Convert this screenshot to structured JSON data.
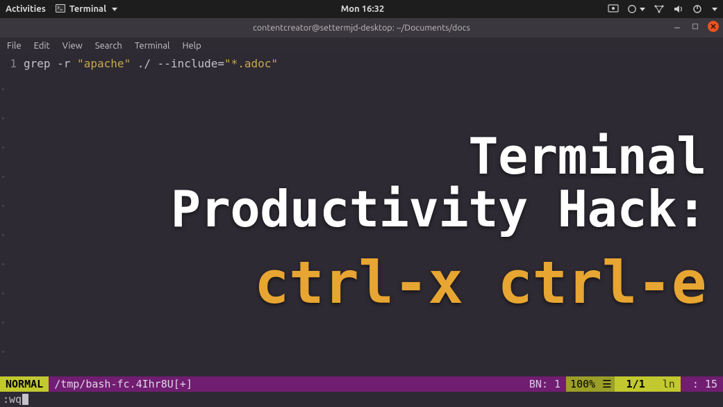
{
  "topbar": {
    "activities": "Activities",
    "app_name": "Terminal",
    "clock": "Mon 16:32"
  },
  "window": {
    "title": "contentcreator@settermjd-desktop: ~/Documents/docs"
  },
  "menubar": {
    "items": [
      "File",
      "Edit",
      "View",
      "Search",
      "Terminal",
      "Help"
    ]
  },
  "editor": {
    "line_number": "1",
    "code_prefix": "grep -r ",
    "code_string": "\"apache\"",
    "code_mid": " ./ --include=",
    "code_string2": "\"*.adoc\""
  },
  "overlay": {
    "line1a": "Terminal",
    "line1b": "Productivity Hack:",
    "line2": "ctrl-x ctrl-e"
  },
  "statusbar": {
    "mode": " NORMAL ",
    "file": "/tmp/bash-fc.4Ihr8U[+]",
    "bn_label": "BN:",
    "bn_value": "1",
    "percent": "100%",
    "position": "1/1",
    "ln_label": "ln",
    "col_sep": ":",
    "col": "15"
  },
  "cmdline": {
    "text": ":wq"
  }
}
